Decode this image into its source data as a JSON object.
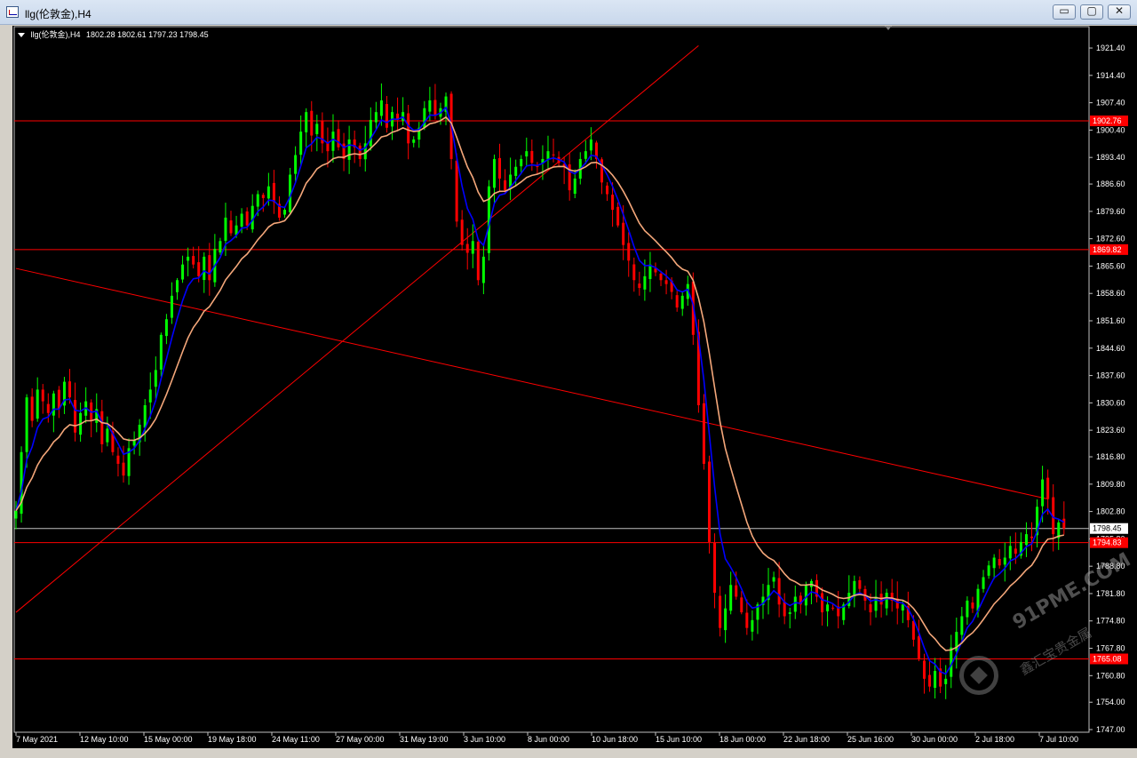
{
  "window": {
    "title": "llg(伦敦金),H4",
    "buttons": {
      "minimize": "▭",
      "maximize": "▢",
      "close": "✕"
    }
  },
  "info_bar": {
    "symbol": "llg(伦敦金),H4",
    "ohlc": "1802.28 1802.61 1797.23 1798.45"
  },
  "watermark": {
    "text": "91PME.COM",
    "subtext": "鑫汇宝贵金属"
  },
  "colors": {
    "background": "#000000",
    "bull": "#00ff00",
    "bear": "#ff0000",
    "fast_ma": "#0000ff",
    "slow_ma": "#f4a77a",
    "hline": "#ff0000",
    "trendline": "#ff0000",
    "bid_line": "#c0c0c0"
  },
  "chart_data": {
    "type": "candlestick",
    "title": "llg(伦敦金),H4",
    "timeframe": "H4",
    "current_price": 1798.45,
    "ylim": [
      1747.0,
      1923.0
    ],
    "y_ticks": [
      1921.4,
      1914.4,
      1907.4,
      1900.4,
      1893.4,
      1886.6,
      1879.6,
      1872.6,
      1865.6,
      1858.6,
      1851.6,
      1844.6,
      1837.6,
      1830.6,
      1823.6,
      1816.8,
      1809.8,
      1802.8,
      1795.8,
      1788.8,
      1781.8,
      1774.8,
      1767.8,
      1760.8,
      1754.0,
      1747.0
    ],
    "y_tick_labels": [
      "1921.40",
      "1914.40",
      "1907.40",
      "1900.40",
      "1893.40",
      "1886.60",
      "1879.60",
      "1872.60",
      "1865.60",
      "1858.60",
      "1851.60",
      "1844.60",
      "1837.60",
      "1830.60",
      "1823.60",
      "1816.80",
      "1809.80",
      "1802.80",
      "1795.80",
      "1788.80",
      "1781.80",
      "1774.80",
      "1767.80",
      "1760.80",
      "1754.00",
      "1747.00"
    ],
    "x_tick_labels": [
      "7 May 2021",
      "12 May 10:00",
      "15 May 00:00",
      "19 May 18:00",
      "24 May 11:00",
      "27 May 00:00",
      "31 May 19:00",
      "3 Jun 10:00",
      "8 Jun 00:00",
      "10 Jun 18:00",
      "15 Jun 10:00",
      "18 Jun 00:00",
      "22 Jun 18:00",
      "25 Jun 16:00",
      "30 Jun 00:00",
      "2 Jul 18:00",
      "7 Jul 10:00"
    ],
    "horizontal_lines": [
      {
        "price": 1902.76,
        "label": "1902.76"
      },
      {
        "price": 1869.82,
        "label": "1869.82"
      },
      {
        "price": 1794.83,
        "label": "1794.83"
      },
      {
        "price": 1765.08,
        "label": "1765.08"
      }
    ],
    "trendlines": [
      {
        "from": {
          "bar": 0,
          "price": 1865.0
        },
        "to": {
          "bar": 192,
          "price": 1806.0
        }
      },
      {
        "from": {
          "bar": 0,
          "price": 1777.0
        },
        "to": {
          "bar": 127,
          "price": 1922.0
        }
      }
    ],
    "closes": [
      1803,
      1818,
      1832,
      1826,
      1834,
      1831,
      1828,
      1833,
      1829,
      1836,
      1832,
      1823,
      1828,
      1831,
      1826,
      1829,
      1820,
      1824,
      1818,
      1815,
      1812,
      1819,
      1821,
      1825,
      1830,
      1834,
      1839,
      1848,
      1852,
      1858,
      1862,
      1866,
      1868,
      1866,
      1863,
      1868,
      1862,
      1870,
      1872,
      1878,
      1874,
      1876,
      1879,
      1876,
      1881,
      1884,
      1883,
      1886,
      1882,
      1878,
      1880,
      1889,
      1894,
      1900,
      1905,
      1899,
      1902,
      1897,
      1895,
      1900,
      1896,
      1893,
      1898,
      1896,
      1893,
      1897,
      1903,
      1905,
      1908,
      1901,
      1905,
      1903,
      1905,
      1897,
      1898,
      1901,
      1906,
      1908,
      1904,
      1906,
      1909,
      1893,
      1877,
      1871,
      1869,
      1872,
      1862,
      1868,
      1886,
      1893,
      1888,
      1885,
      1889,
      1891,
      1893,
      1895,
      1892,
      1891,
      1893,
      1895,
      1894,
      1892,
      1891,
      1885,
      1888,
      1893,
      1895,
      1898,
      1893,
      1887,
      1884,
      1880,
      1876,
      1871,
      1867,
      1862,
      1860,
      1863,
      1866,
      1864,
      1862,
      1861,
      1859,
      1855,
      1858,
      1861,
      1848,
      1830,
      1815,
      1795,
      1782,
      1773,
      1778,
      1784,
      1781,
      1777,
      1773,
      1775,
      1779,
      1781,
      1784,
      1786,
      1779,
      1776,
      1777,
      1781,
      1779,
      1784,
      1785,
      1781,
      1777,
      1779,
      1778,
      1776,
      1779,
      1782,
      1785,
      1783,
      1780,
      1777,
      1781,
      1779,
      1782,
      1780,
      1778,
      1779,
      1775,
      1770,
      1765,
      1760,
      1758,
      1762,
      1758,
      1760,
      1768,
      1772,
      1776,
      1780,
      1778,
      1783,
      1786,
      1789,
      1791,
      1789,
      1791,
      1794,
      1792,
      1795,
      1797,
      1796,
      1804,
      1811,
      1806,
      1797,
      1800,
      1798.45
    ],
    "fast_ma_period": 5,
    "slow_ma_period": 13
  }
}
